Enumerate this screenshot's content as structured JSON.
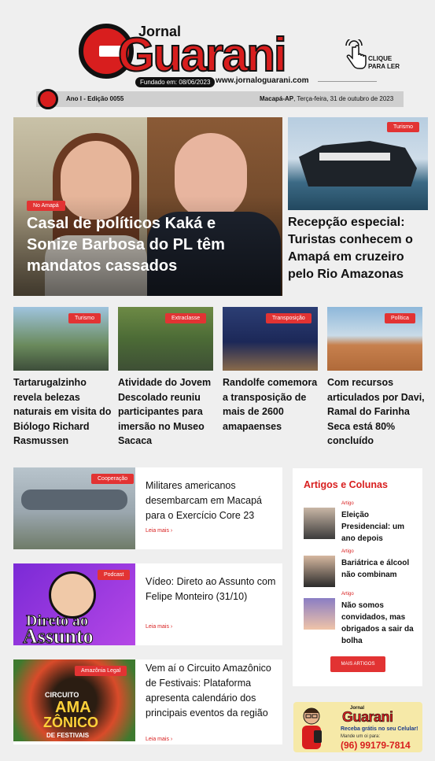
{
  "header": {
    "jornal": "Jornal",
    "brand": "Guarani",
    "fundado": "Fundado em: 08/06/2023",
    "site": "www.jornaloguarani.com",
    "click": "CLIQUE PARA LER",
    "edition": "Ano I - Edição 0055",
    "place": "Macapá-AP",
    "date": ", Terça-feira, 31 de outubro de 2023"
  },
  "hero": {
    "tag": "No Amapá",
    "title": "Casal de políticos Kaká e Sonize Barbosa do PL têm mandatos cassados"
  },
  "side": {
    "tag": "Turismo",
    "title": "Recepção especial: Turistas conhecem o Amapá em cruzeiro pelo Rio Amazonas"
  },
  "row": [
    {
      "tag": "Turismo",
      "title": "Tartarugalzinho revela belezas naturais em visita do Biólogo Richard Rasmussen"
    },
    {
      "tag": "Extraclasse",
      "title": "Atividade do Jovem Descolado reuniu participantes para imersão no Museo Sacaca"
    },
    {
      "tag": "Transposição",
      "title": "Randolfe comemora a transposição de mais de 2600 amapaenses"
    },
    {
      "tag": "Política",
      "title": "Com recursos articulados por Davi, Ramal do Farinha Seca está 80% concluído"
    }
  ],
  "list": [
    {
      "tag": "Cooperação",
      "title": "Militares americanos desembarcam em Macapá para o Exercício Core 23",
      "leia": "Leia mais ›"
    },
    {
      "tag": "Podcast",
      "title": "Vídeo: Direto ao Assunto com Felipe Monteiro (31/10)",
      "leia": "Leia mais ›",
      "img1": "Direto ao",
      "img2": "Assunto"
    },
    {
      "tag": "Amazônia Legal",
      "title": "Vem aí o Circuito Amazônico de Festivais: Plataforma apresenta calendário dos principais eventos da região",
      "leia": "Leia mais ›",
      "img1": "CIRCUITO",
      "img2": "AMA",
      "img3": "ZÔNICO",
      "img4": "DE FESTIVAIS"
    }
  ],
  "artigos": {
    "heading": "Artigos e Colunas",
    "items": [
      {
        "kind": "Artigo",
        "title": "Eleição Presidencial: um ano depois"
      },
      {
        "kind": "Artigo",
        "title": "Bariátrica e álcool não combinam"
      },
      {
        "kind": "Artigo",
        "title": "Não somos convidados, mas obrigados a sair da bolha"
      }
    ],
    "button": "MAIS ARTIGOS"
  },
  "ad": {
    "jornal": "Jornal",
    "brand": "Guarani",
    "line1": "Receba grátis no seu Celular!",
    "line2": "Mande um oi para:",
    "phone": "(96) 99179-7814"
  },
  "colors": {
    "accent": "#d81e1e",
    "tag": "#e23333"
  }
}
